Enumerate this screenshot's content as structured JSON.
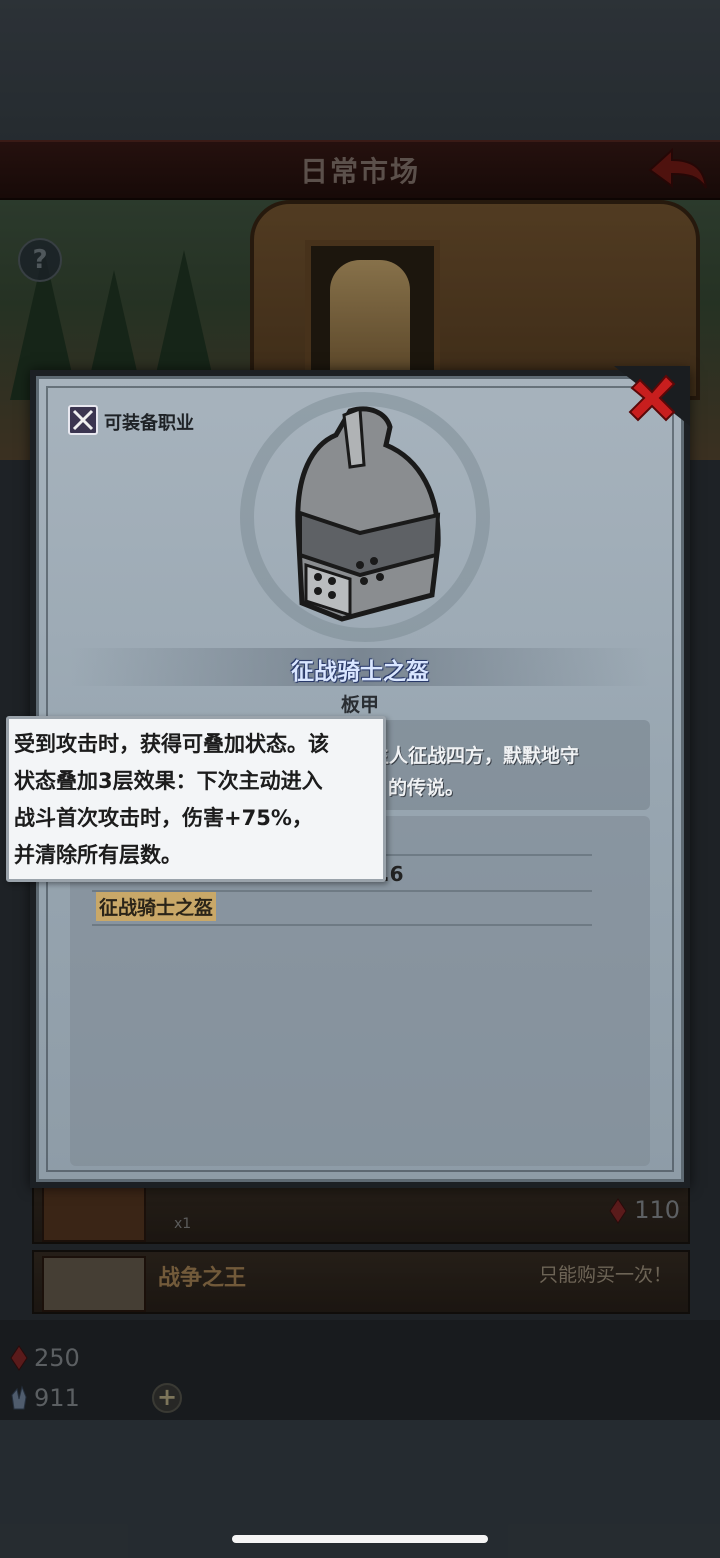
{
  "header": {
    "title": "日常市场"
  },
  "shop": {
    "rows": [
      {
        "qty": "x1",
        "price": "110"
      },
      {
        "name": "战争之王",
        "limit": "只能购买一次！"
      }
    ]
  },
  "currency": {
    "gems": "250",
    "crystals": "911"
  },
  "item_popup": {
    "class_label": "可装备职业",
    "name": "征战骑士之盔",
    "type": "板甲",
    "description": [
      "主人征战四方，默默地守",
      "的传说。"
    ],
    "stat_value": ".6",
    "set_name": "征战骑士之盔"
  },
  "tooltip": {
    "lines": [
      "受到攻击时，获得可叠加状态。该",
      "状态叠加3层效果：下次主动进入",
      "战斗首次攻击时，伤害+75%，",
      "并清除所有层数。"
    ]
  },
  "colors": {
    "accent_red": "#c81e1e",
    "item_name_blue": "#d9e6ff",
    "set_gold": "#c9a868"
  }
}
